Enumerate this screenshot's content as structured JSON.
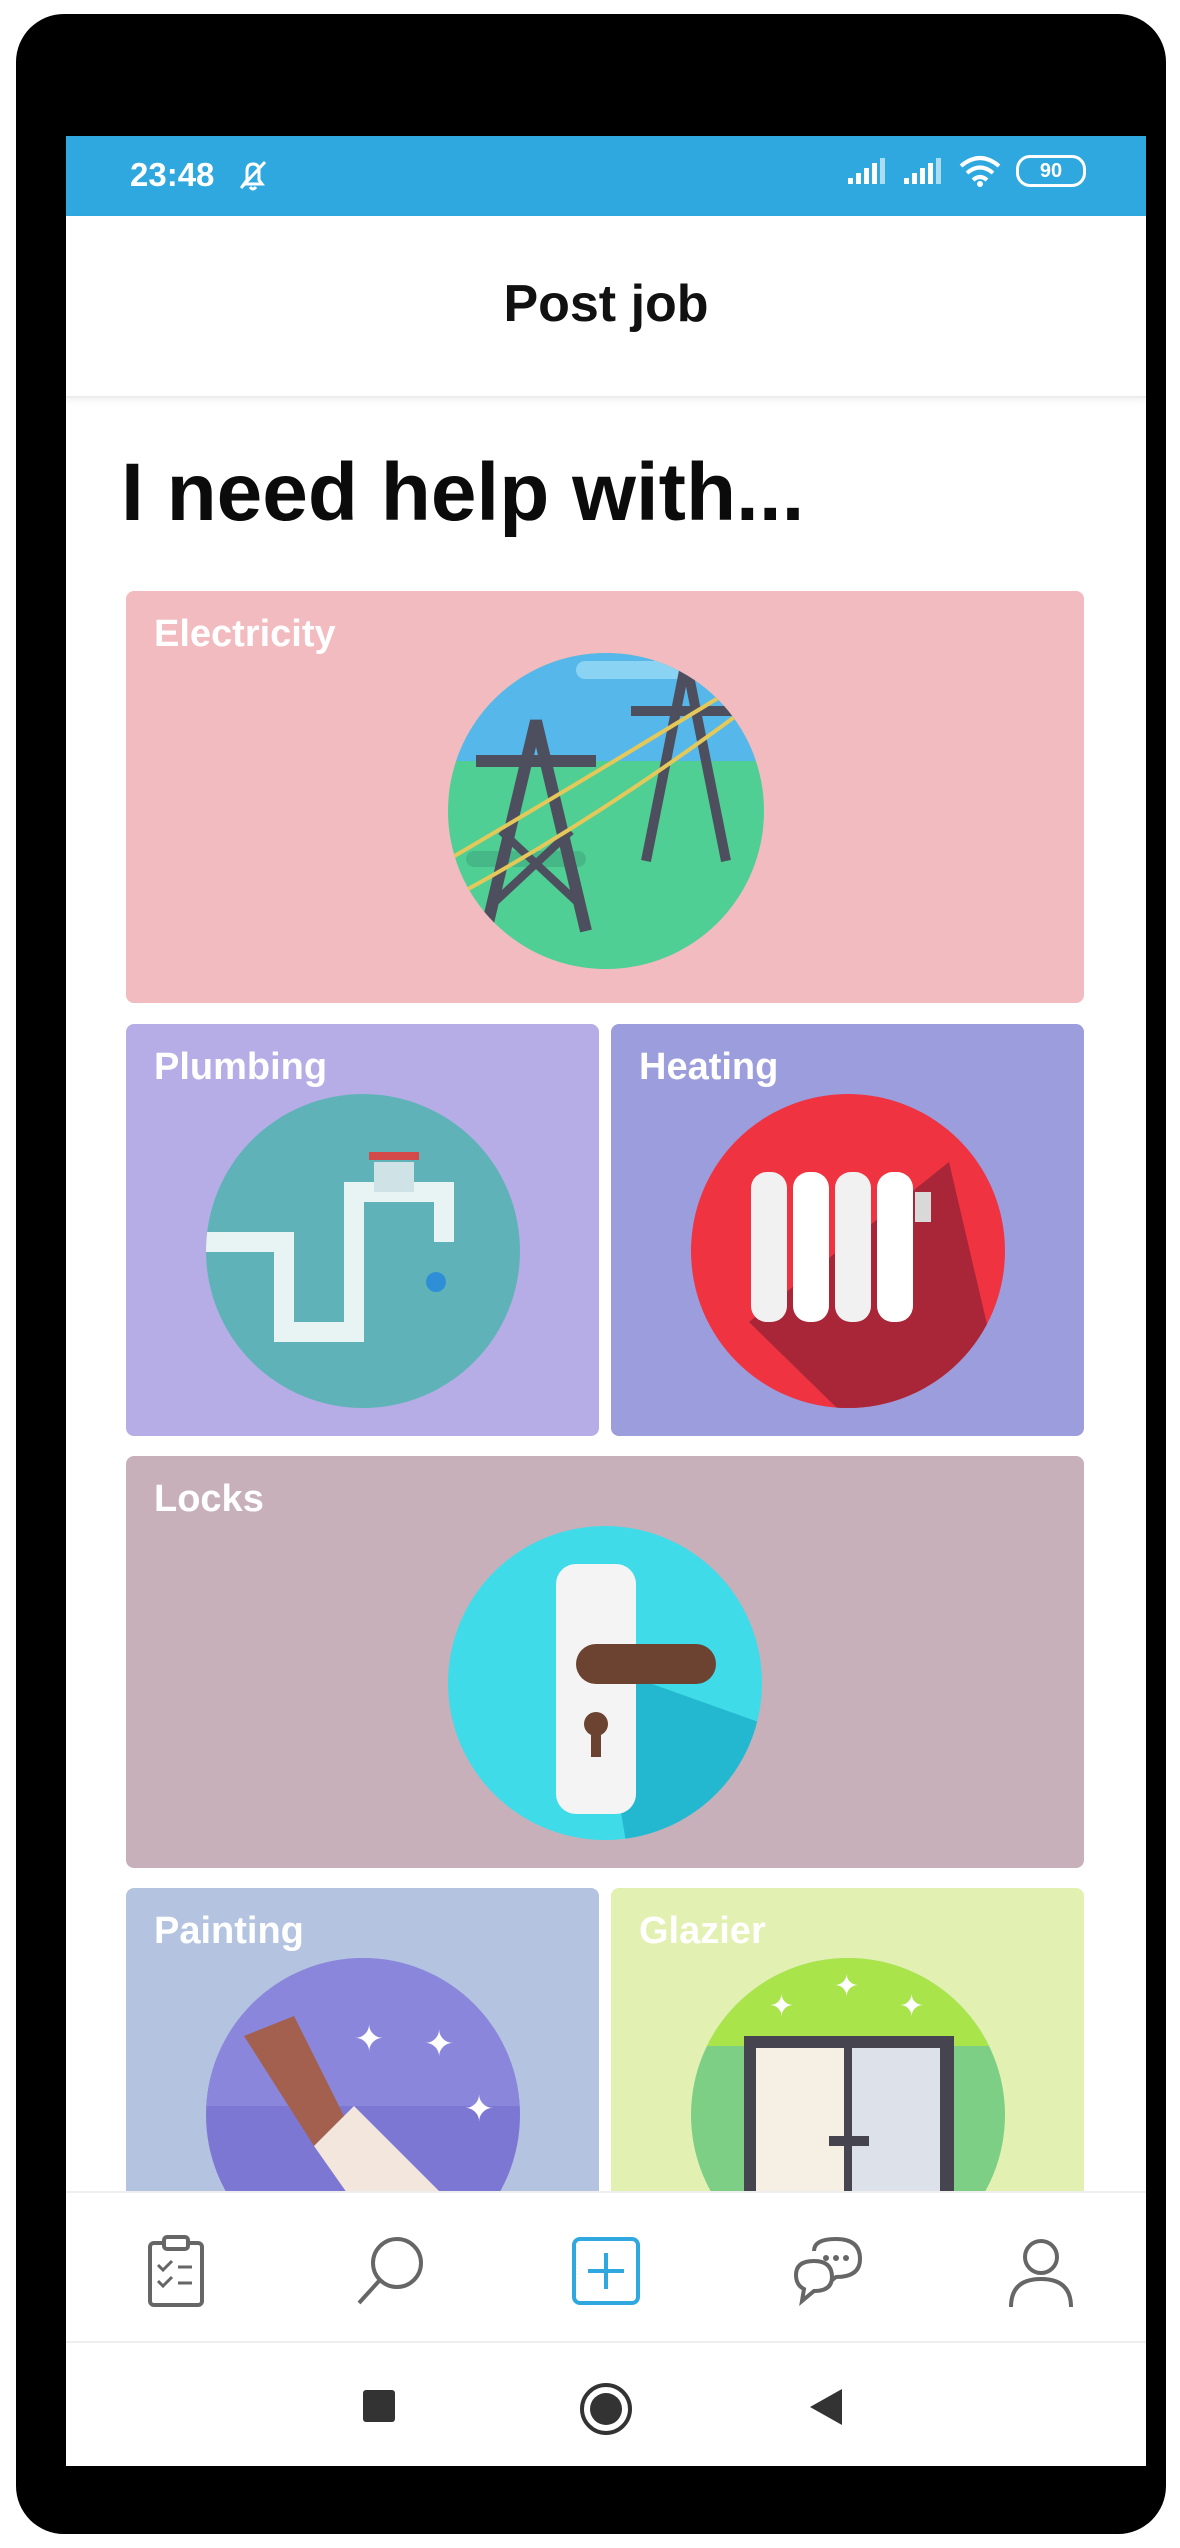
{
  "status_bar": {
    "time": "23:48",
    "battery": "90",
    "icons": [
      "bell-off-icon",
      "signal-icon",
      "signal-icon",
      "wifi-icon",
      "battery-icon"
    ]
  },
  "app_bar": {
    "title": "Post job"
  },
  "main": {
    "heading": "I need help with...",
    "categories": [
      {
        "label": "Electricity",
        "color": "#f2bbc0",
        "icon": "power-pylon-icon"
      },
      {
        "label": "Plumbing",
        "color": "#b6ade6",
        "icon": "water-pipe-icon"
      },
      {
        "label": "Heating",
        "color": "#9b9ddc",
        "icon": "radiator-icon"
      },
      {
        "label": "Locks",
        "color": "#c8b0bb",
        "icon": "door-handle-icon"
      },
      {
        "label": "Painting",
        "color": "#b3c3e0",
        "icon": "paintbrush-icon"
      },
      {
        "label": "Glazier",
        "color": "#e2f0b2",
        "icon": "glass-door-icon"
      }
    ]
  },
  "bottom_nav": {
    "items": [
      "clipboard-checklist-icon",
      "search-icon",
      "add-job-icon",
      "chat-icon",
      "profile-icon"
    ],
    "active_color": "#2fa7df"
  },
  "system_nav": {
    "items": [
      "recents-square-icon",
      "home-circle-icon",
      "back-triangle-icon"
    ]
  }
}
